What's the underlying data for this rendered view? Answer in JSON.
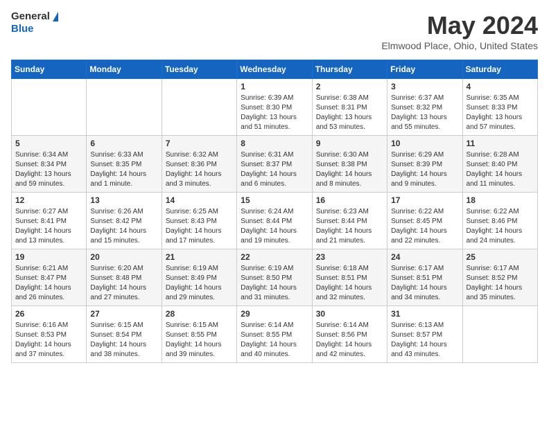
{
  "header": {
    "logo_general": "General",
    "logo_blue": "Blue",
    "month_title": "May 2024",
    "location": "Elmwood Place, Ohio, United States"
  },
  "weekdays": [
    "Sunday",
    "Monday",
    "Tuesday",
    "Wednesday",
    "Thursday",
    "Friday",
    "Saturday"
  ],
  "weeks": [
    [
      {
        "day": "",
        "sunrise": "",
        "sunset": "",
        "daylight": ""
      },
      {
        "day": "",
        "sunrise": "",
        "sunset": "",
        "daylight": ""
      },
      {
        "day": "",
        "sunrise": "",
        "sunset": "",
        "daylight": ""
      },
      {
        "day": "1",
        "sunrise": "6:39 AM",
        "sunset": "8:30 PM",
        "daylight": "13 hours and 51 minutes."
      },
      {
        "day": "2",
        "sunrise": "6:38 AM",
        "sunset": "8:31 PM",
        "daylight": "13 hours and 53 minutes."
      },
      {
        "day": "3",
        "sunrise": "6:37 AM",
        "sunset": "8:32 PM",
        "daylight": "13 hours and 55 minutes."
      },
      {
        "day": "4",
        "sunrise": "6:35 AM",
        "sunset": "8:33 PM",
        "daylight": "13 hours and 57 minutes."
      }
    ],
    [
      {
        "day": "5",
        "sunrise": "6:34 AM",
        "sunset": "8:34 PM",
        "daylight": "13 hours and 59 minutes."
      },
      {
        "day": "6",
        "sunrise": "6:33 AM",
        "sunset": "8:35 PM",
        "daylight": "14 hours and 1 minute."
      },
      {
        "day": "7",
        "sunrise": "6:32 AM",
        "sunset": "8:36 PM",
        "daylight": "14 hours and 3 minutes."
      },
      {
        "day": "8",
        "sunrise": "6:31 AM",
        "sunset": "8:37 PM",
        "daylight": "14 hours and 6 minutes."
      },
      {
        "day": "9",
        "sunrise": "6:30 AM",
        "sunset": "8:38 PM",
        "daylight": "14 hours and 8 minutes."
      },
      {
        "day": "10",
        "sunrise": "6:29 AM",
        "sunset": "8:39 PM",
        "daylight": "14 hours and 9 minutes."
      },
      {
        "day": "11",
        "sunrise": "6:28 AM",
        "sunset": "8:40 PM",
        "daylight": "14 hours and 11 minutes."
      }
    ],
    [
      {
        "day": "12",
        "sunrise": "6:27 AM",
        "sunset": "8:41 PM",
        "daylight": "14 hours and 13 minutes."
      },
      {
        "day": "13",
        "sunrise": "6:26 AM",
        "sunset": "8:42 PM",
        "daylight": "14 hours and 15 minutes."
      },
      {
        "day": "14",
        "sunrise": "6:25 AM",
        "sunset": "8:43 PM",
        "daylight": "14 hours and 17 minutes."
      },
      {
        "day": "15",
        "sunrise": "6:24 AM",
        "sunset": "8:44 PM",
        "daylight": "14 hours and 19 minutes."
      },
      {
        "day": "16",
        "sunrise": "6:23 AM",
        "sunset": "8:44 PM",
        "daylight": "14 hours and 21 minutes."
      },
      {
        "day": "17",
        "sunrise": "6:22 AM",
        "sunset": "8:45 PM",
        "daylight": "14 hours and 22 minutes."
      },
      {
        "day": "18",
        "sunrise": "6:22 AM",
        "sunset": "8:46 PM",
        "daylight": "14 hours and 24 minutes."
      }
    ],
    [
      {
        "day": "19",
        "sunrise": "6:21 AM",
        "sunset": "8:47 PM",
        "daylight": "14 hours and 26 minutes."
      },
      {
        "day": "20",
        "sunrise": "6:20 AM",
        "sunset": "8:48 PM",
        "daylight": "14 hours and 27 minutes."
      },
      {
        "day": "21",
        "sunrise": "6:19 AM",
        "sunset": "8:49 PM",
        "daylight": "14 hours and 29 minutes."
      },
      {
        "day": "22",
        "sunrise": "6:19 AM",
        "sunset": "8:50 PM",
        "daylight": "14 hours and 31 minutes."
      },
      {
        "day": "23",
        "sunrise": "6:18 AM",
        "sunset": "8:51 PM",
        "daylight": "14 hours and 32 minutes."
      },
      {
        "day": "24",
        "sunrise": "6:17 AM",
        "sunset": "8:51 PM",
        "daylight": "14 hours and 34 minutes."
      },
      {
        "day": "25",
        "sunrise": "6:17 AM",
        "sunset": "8:52 PM",
        "daylight": "14 hours and 35 minutes."
      }
    ],
    [
      {
        "day": "26",
        "sunrise": "6:16 AM",
        "sunset": "8:53 PM",
        "daylight": "14 hours and 37 minutes."
      },
      {
        "day": "27",
        "sunrise": "6:15 AM",
        "sunset": "8:54 PM",
        "daylight": "14 hours and 38 minutes."
      },
      {
        "day": "28",
        "sunrise": "6:15 AM",
        "sunset": "8:55 PM",
        "daylight": "14 hours and 39 minutes."
      },
      {
        "day": "29",
        "sunrise": "6:14 AM",
        "sunset": "8:55 PM",
        "daylight": "14 hours and 40 minutes."
      },
      {
        "day": "30",
        "sunrise": "6:14 AM",
        "sunset": "8:56 PM",
        "daylight": "14 hours and 42 minutes."
      },
      {
        "day": "31",
        "sunrise": "6:13 AM",
        "sunset": "8:57 PM",
        "daylight": "14 hours and 43 minutes."
      },
      {
        "day": "",
        "sunrise": "",
        "sunset": "",
        "daylight": ""
      }
    ]
  ],
  "labels": {
    "sunrise_prefix": "Sunrise: ",
    "sunset_prefix": "Sunset: ",
    "daylight_prefix": "Daylight: "
  }
}
